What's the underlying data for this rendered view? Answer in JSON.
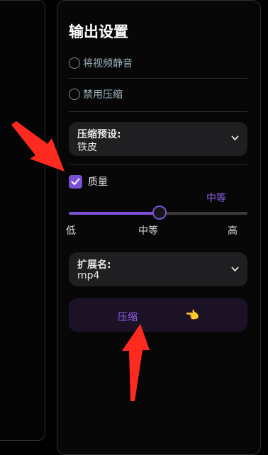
{
  "settings_title": "输出设置",
  "mute_video": {
    "label": "将视频静音",
    "checked": false
  },
  "disable_compression": {
    "label": "禁用压缩",
    "checked": false
  },
  "compression_preset": {
    "label": "压缩预设:",
    "value": "铁皮"
  },
  "quality": {
    "label": "质量",
    "checked": true,
    "current_label": "中等",
    "level_fraction": 0.5,
    "ticks": {
      "low": "低",
      "mid": "中等",
      "high": "高"
    }
  },
  "extension": {
    "label": "扩展名:",
    "value": "mp4"
  },
  "compress_button": {
    "label": "压缩",
    "emoji": "👈"
  },
  "colors": {
    "accent": "#7b4fd6",
    "annotation_arrow": "#ff2a1f",
    "panel_bg": "#070707"
  },
  "icons": [
    "checkmark-icon",
    "chevron-down-icon",
    "pointing-hand-icon",
    "annotation-arrow"
  ]
}
